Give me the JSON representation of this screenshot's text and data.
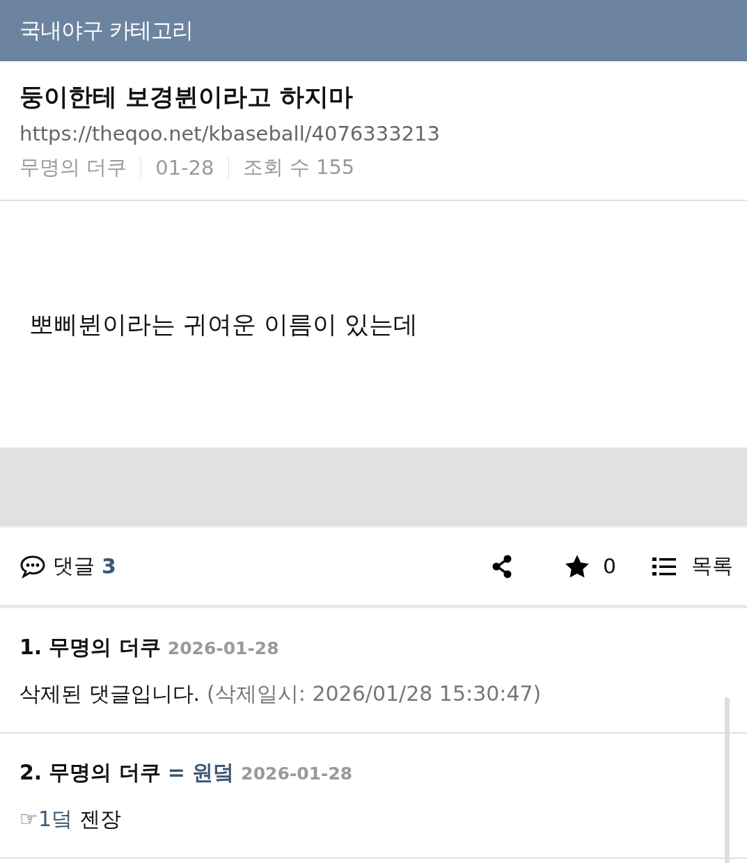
{
  "header": {
    "title": "국내야구 카테고리"
  },
  "post": {
    "title": "둥이한테 보경뷘이라고 하지마",
    "url": "https://theqoo.net/kbaseball/4076333213",
    "meta": [
      "무명의 더쿠",
      "01-28",
      "조회 수 155"
    ],
    "body": "뽀삐뷘이라는 귀여운 이름이 있는데"
  },
  "toolbar": {
    "comment_label": "댓글",
    "comment_count": "3",
    "star_count": "0",
    "list_label": "목록"
  },
  "comments": [
    {
      "number": "1.",
      "author": "무명의 더쿠",
      "date": "2026-01-28",
      "body": [
        {
          "kind": "text",
          "text": "삭제된 댓글입니다."
        },
        {
          "kind": "note",
          "text": "(삭제일시: 2026/01/28 15:30:47)"
        }
      ]
    },
    {
      "number": "2.",
      "author": "무명의 더쿠",
      "op_tag": "= 원덬",
      "date": "2026-01-28",
      "body": [
        {
          "kind": "link",
          "text": "☞1덬"
        },
        {
          "kind": "text",
          "text": "젠장"
        }
      ]
    }
  ]
}
